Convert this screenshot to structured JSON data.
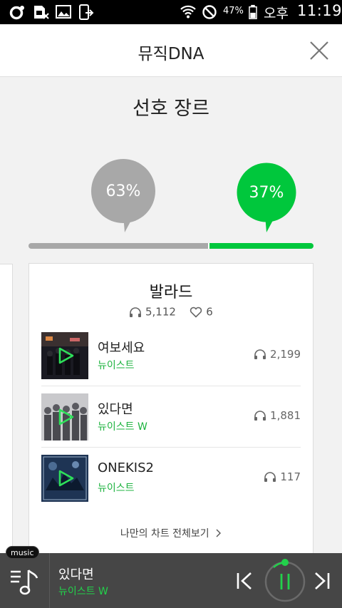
{
  "status_bar": {
    "battery_percent": "47%",
    "ampm": "오후",
    "time": "11:19",
    "icons": [
      "notification-o-icon",
      "sim-blocked-icon",
      "gallery-icon",
      "phone-transfer-icon",
      "wifi-icon",
      "no-sound-icon",
      "battery-icon"
    ]
  },
  "header": {
    "title": "뮤직DNA",
    "close_icon": "close-icon"
  },
  "genre": {
    "title": "선호 장르",
    "left_percent_label": "63%",
    "right_percent_label": "37%",
    "left_percent": 63,
    "right_percent": 37,
    "left_color": "#a8a8a8",
    "right_color": "#00c73c"
  },
  "card": {
    "genre_name": "발라드",
    "listen_count": "5,112",
    "like_count": "6",
    "tracks": [
      {
        "title": "여보세요",
        "artist": "뉴이스트",
        "plays": "2,199"
      },
      {
        "title": "있다면",
        "artist": "뉴이스트 W",
        "plays": "1,881"
      },
      {
        "title": "ONEKIS2",
        "artist": "뉴이스트",
        "plays": "117"
      }
    ],
    "more_label": "나만의 차트 전체보기"
  },
  "player": {
    "badge": "music",
    "title": "있다면",
    "artist": "뉴이스트 W",
    "accent": "#22d24b"
  }
}
